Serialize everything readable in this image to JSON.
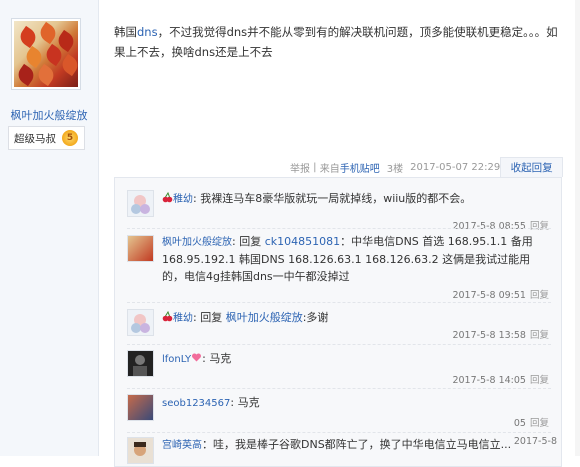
{
  "poster": {
    "name": "枫叶加火般绽放",
    "level_title": "超级马叔",
    "level_number": "5"
  },
  "post": {
    "content_pre": "韩国",
    "content_link": "dns",
    "content_post": "，不过我觉得dns并不能从零到有的解决联机问题，顶多能使联机更稳定。。。如果上不去，换啥dns还是上不去"
  },
  "tail": {
    "report": "举报",
    "from_prefix": "来自",
    "client": "手机贴吧",
    "floor": "3楼",
    "time": "2017-05-07 22:29",
    "toggle_replies": "收起回复"
  },
  "replies": [
    {
      "nick": "稚幼",
      "sep": ": ",
      "text": "我裸连马车8豪华版就玩一局就掉线，wiiu版的都不会。",
      "time": "2017-5-8 08:55",
      "reply_label": "回复"
    },
    {
      "nick": "枫叶加火般绽放",
      "sep": ": ",
      "reply_prefix": "回复 ",
      "at_user": "ck104851081",
      "text": "：中华电信DNS 首选 168.95.1.1 备用 168.95.192.1 韩国DNS 168.126.63.1 168.126.63.2 这俩是我试过能用的，电信4g挂韩国dns一中午都没掉过",
      "time": "2017-5-8 09:51",
      "reply_label": "回复"
    },
    {
      "nick": "稚幼",
      "sep": ": ",
      "reply_prefix": "回复 ",
      "at_user": "枫叶加火般绽放",
      "text": ":多谢",
      "time": "2017-5-8 13:58",
      "reply_label": "回复"
    },
    {
      "nick": "lfonLY",
      "sep": ": ",
      "text": "马克",
      "time": "2017-5-8 14:05",
      "reply_label": "回复"
    },
    {
      "nick": "seob1234567",
      "sep": ": ",
      "text": "马克",
      "time": "05",
      "reply_label": "回复"
    },
    {
      "nick": "宫崎英高",
      "sep": "：",
      "text": "哇，我是棒子谷歌DNS都阵亡了，换了中华电信立马电信立...",
      "time": "2017-5-8",
      "reply_label": ""
    }
  ],
  "colors": {
    "link": "#2d64b3",
    "meta": "#999999",
    "reply_bg": "#f7f8fa"
  }
}
